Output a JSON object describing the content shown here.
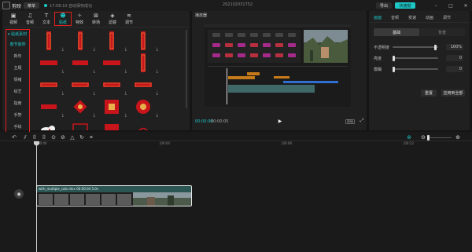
{
  "app": {
    "name": "剪映",
    "menu_label": "菜单",
    "save_status": "17:58:10 自动保存成功",
    "project_title": "202102031752"
  },
  "topbar": {
    "export_label": "导出",
    "shortcut_label": "快捷键"
  },
  "toolbar": {
    "tabs": [
      {
        "label": "视频",
        "icon": "▣"
      },
      {
        "label": "音频",
        "icon": "♫"
      },
      {
        "label": "文本",
        "icon": "T"
      },
      {
        "label": "贴纸",
        "icon": "☻"
      },
      {
        "label": "特效",
        "icon": "✧"
      },
      {
        "label": "转场",
        "icon": "⊠"
      },
      {
        "label": "滤镜",
        "icon": "◈"
      },
      {
        "label": "调节",
        "icon": "≋"
      }
    ],
    "active_index": 3
  },
  "categories": [
    "▾ 贴纸素材",
    "春节装饰",
    "新年",
    "主题",
    "情绪",
    "综艺",
    "指南",
    "手势",
    "手绘",
    "…"
  ],
  "player": {
    "label": "播放器",
    "time_current": "00:00:00",
    "time_total": "00:00:05",
    "fullscreen_label": "原始"
  },
  "props": {
    "tabs": [
      "画面",
      "音频",
      "变速",
      "动画",
      "调节"
    ],
    "subtabs": [
      "基础",
      "背景"
    ],
    "rows": [
      {
        "label": "不透明度",
        "value": "100%",
        "level": 0.95
      },
      {
        "label": "亮度",
        "value": "0",
        "level": 0.0
      },
      {
        "label": "模糊",
        "value": "0",
        "level": 0.0
      }
    ],
    "reset_label": "重置",
    "apply_all_label": "应用到全部"
  },
  "timeline": {
    "ticks": [
      "00:00",
      "|00:04",
      "|00:08",
      "|00:12"
    ],
    "clip_title": "with_multiple_cats.mkv 00:00:04 5.0s"
  },
  "colors": {
    "accent": "#1ec7c7",
    "highlight": "#e02020",
    "sticker_red": "#c8151b"
  }
}
